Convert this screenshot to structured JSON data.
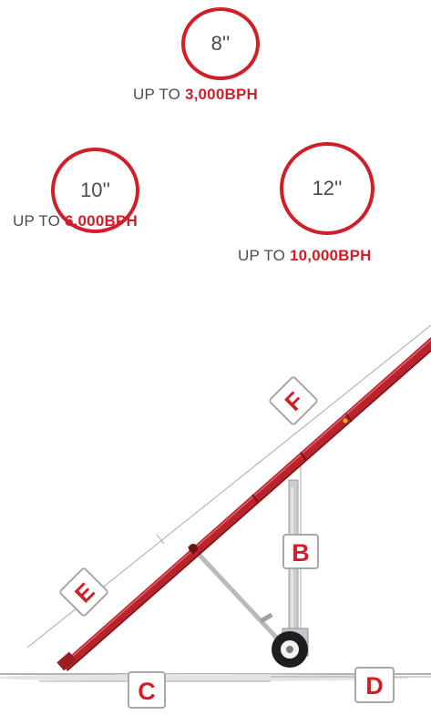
{
  "sizes": [
    {
      "diameter": "8''",
      "prefix": "UP TO ",
      "capacity": "3,000BPH"
    },
    {
      "diameter": "10''",
      "prefix": "UP TO ",
      "capacity": "6,000BPH"
    },
    {
      "diameter": "12''",
      "prefix": "UP TO ",
      "capacity": "10,000BPH"
    }
  ],
  "dimension_labels": {
    "b": "B",
    "c": "C",
    "d": "D",
    "e": "E",
    "f": "F"
  },
  "colors": {
    "accent": "#d11f2a",
    "text": "#4d4d4d",
    "line": "#9a9a9a",
    "metal": "#c9ccd0"
  }
}
